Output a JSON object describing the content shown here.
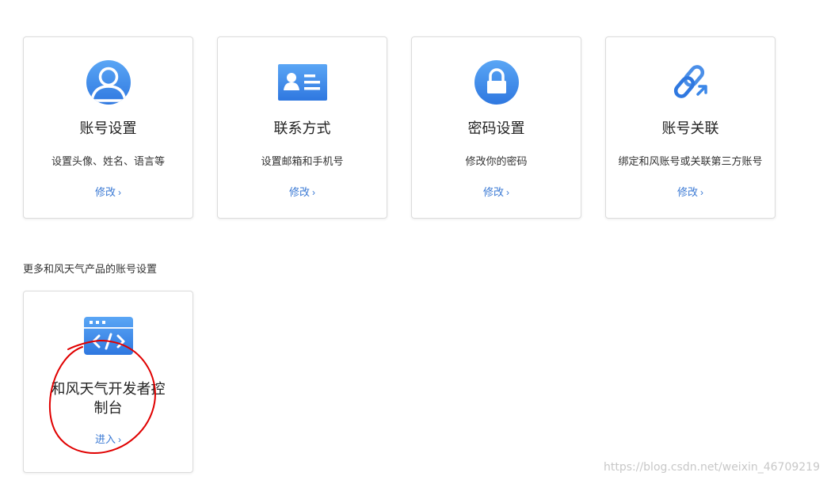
{
  "cards": [
    {
      "icon": "user-avatar-icon",
      "title": "账号设置",
      "desc": "设置头像、姓名、语言等",
      "link": "修改"
    },
    {
      "icon": "contact-card-icon",
      "title": "联系方式",
      "desc": "设置邮箱和手机号",
      "link": "修改"
    },
    {
      "icon": "lock-icon",
      "title": "密码设置",
      "desc": "修改你的密码",
      "link": "修改"
    },
    {
      "icon": "link-chain-icon",
      "title": "账号关联",
      "desc": "绑定和风账号或关联第三方账号",
      "link": "修改"
    }
  ],
  "more_section": {
    "label": "更多和风天气产品的账号设置",
    "card": {
      "icon": "code-window-icon",
      "title": "和风天气开发者控制台",
      "link": "进入"
    }
  },
  "watermark": "https://blog.csdn.net/weixin_46709219",
  "colors": {
    "accent": "#3a79d4",
    "icon_blue": "#3b87e8",
    "annotation_red": "#e00000"
  }
}
